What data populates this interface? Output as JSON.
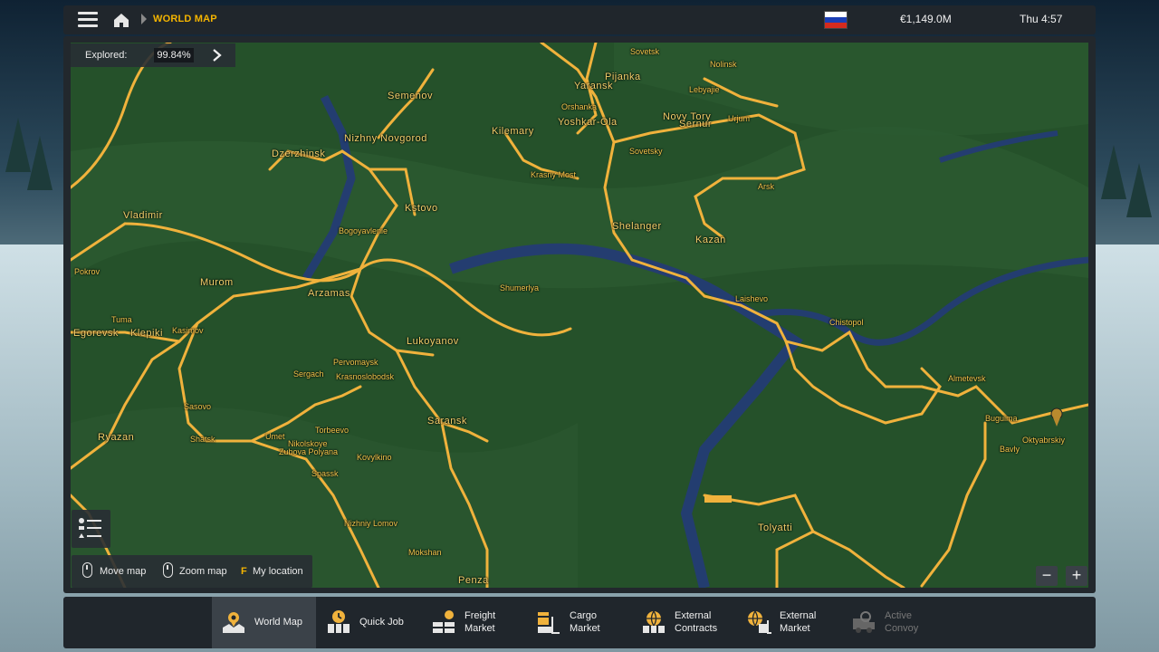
{
  "header": {
    "breadcrumb": "WORLD MAP",
    "money": "€1,149.0M",
    "time": "Thu 4:57",
    "flag_colors": [
      "#ffffff",
      "#1c3fb5",
      "#d52b1e"
    ]
  },
  "explored": {
    "label": "Explored:",
    "value": "99.84%"
  },
  "map": {
    "colors": {
      "land": "#25512a",
      "road": "#f0b23c",
      "water": "#243b78"
    },
    "cities": [
      {
        "name": "Nizhny Novgorod",
        "big": true
      },
      {
        "name": "Dzerzhinsk",
        "big": true
      },
      {
        "name": "Semenov",
        "big": true
      },
      {
        "name": "Kstovo",
        "big": true
      },
      {
        "name": "Bogoyavlenie",
        "big": false
      },
      {
        "name": "Vladimir",
        "big": true
      },
      {
        "name": "Pokrov",
        "big": false
      },
      {
        "name": "Murom",
        "big": true
      },
      {
        "name": "Arzamas",
        "big": true
      },
      {
        "name": "Shumerlya",
        "big": false
      },
      {
        "name": "Lukoyanov",
        "big": true
      },
      {
        "name": "Pervomaysk",
        "big": false
      },
      {
        "name": "Sergach",
        "big": false
      },
      {
        "name": "Krasnoslobodsk",
        "big": false
      },
      {
        "name": "Tuma",
        "big": false
      },
      {
        "name": "Kasimov",
        "big": false
      },
      {
        "name": "Egorevsk",
        "big": true
      },
      {
        "name": "Klepiki",
        "big": true
      },
      {
        "name": "Sasovo",
        "big": false
      },
      {
        "name": "Shatsk",
        "big": false
      },
      {
        "name": "Ryazan",
        "big": true
      },
      {
        "name": "Umet",
        "big": false
      },
      {
        "name": "Torbeevo",
        "big": false
      },
      {
        "name": "Nikolskoye",
        "big": false
      },
      {
        "name": "Zubova Polyana",
        "big": false
      },
      {
        "name": "Kovylkino",
        "big": false
      },
      {
        "name": "Spassk",
        "big": false
      },
      {
        "name": "Saransk",
        "big": true
      },
      {
        "name": "Nizhniy Lomov",
        "big": false
      },
      {
        "name": "Mokshan",
        "big": false
      },
      {
        "name": "Penza",
        "big": true
      },
      {
        "name": "Sovetsk",
        "big": false
      },
      {
        "name": "Nolinsk",
        "big": false
      },
      {
        "name": "Pijanka",
        "big": true
      },
      {
        "name": "Yaransk",
        "big": true
      },
      {
        "name": "Lebyajie",
        "big": false
      },
      {
        "name": "Orshanka",
        "big": false
      },
      {
        "name": "Kilemary",
        "big": true
      },
      {
        "name": "Yoshkar-Ola",
        "big": true
      },
      {
        "name": "Novy Tory",
        "big": true
      },
      {
        "name": "Sernur",
        "big": true
      },
      {
        "name": "Urjum",
        "big": false
      },
      {
        "name": "Sovetsky",
        "big": false
      },
      {
        "name": "Krasny Most",
        "big": false
      },
      {
        "name": "Arsk",
        "big": false
      },
      {
        "name": "Shelanger",
        "big": true
      },
      {
        "name": "Kazan",
        "big": true
      },
      {
        "name": "Laishevo",
        "big": false
      },
      {
        "name": "Chistopol",
        "big": false
      },
      {
        "name": "Almetevsk",
        "big": false
      },
      {
        "name": "Bugulma",
        "big": false
      },
      {
        "name": "Bavly",
        "big": false
      },
      {
        "name": "Oktyabrskiy",
        "big": false
      },
      {
        "name": "Tolyatti",
        "big": true
      }
    ]
  },
  "controls": {
    "move": "Move map",
    "zoom": "Zoom map",
    "location_key": "F",
    "location": "My location",
    "zoom_out": "−",
    "zoom_in": "+"
  },
  "tabs": [
    {
      "line1": "World Map",
      "line2": "",
      "active": true,
      "disabled": false,
      "icon": "world-map-icon"
    },
    {
      "line1": "Quick Job",
      "line2": "",
      "active": false,
      "disabled": false,
      "icon": "quick-job-icon"
    },
    {
      "line1": "Freight",
      "line2": "Market",
      "active": false,
      "disabled": false,
      "icon": "freight-market-icon"
    },
    {
      "line1": "Cargo",
      "line2": "Market",
      "active": false,
      "disabled": false,
      "icon": "cargo-market-icon"
    },
    {
      "line1": "External",
      "line2": "Contracts",
      "active": false,
      "disabled": false,
      "icon": "external-contracts-icon"
    },
    {
      "line1": "External",
      "line2": "Market",
      "active": false,
      "disabled": false,
      "icon": "external-market-icon"
    },
    {
      "line1": "Active",
      "line2": "Convoy",
      "active": false,
      "disabled": true,
      "icon": "active-convoy-icon"
    }
  ]
}
